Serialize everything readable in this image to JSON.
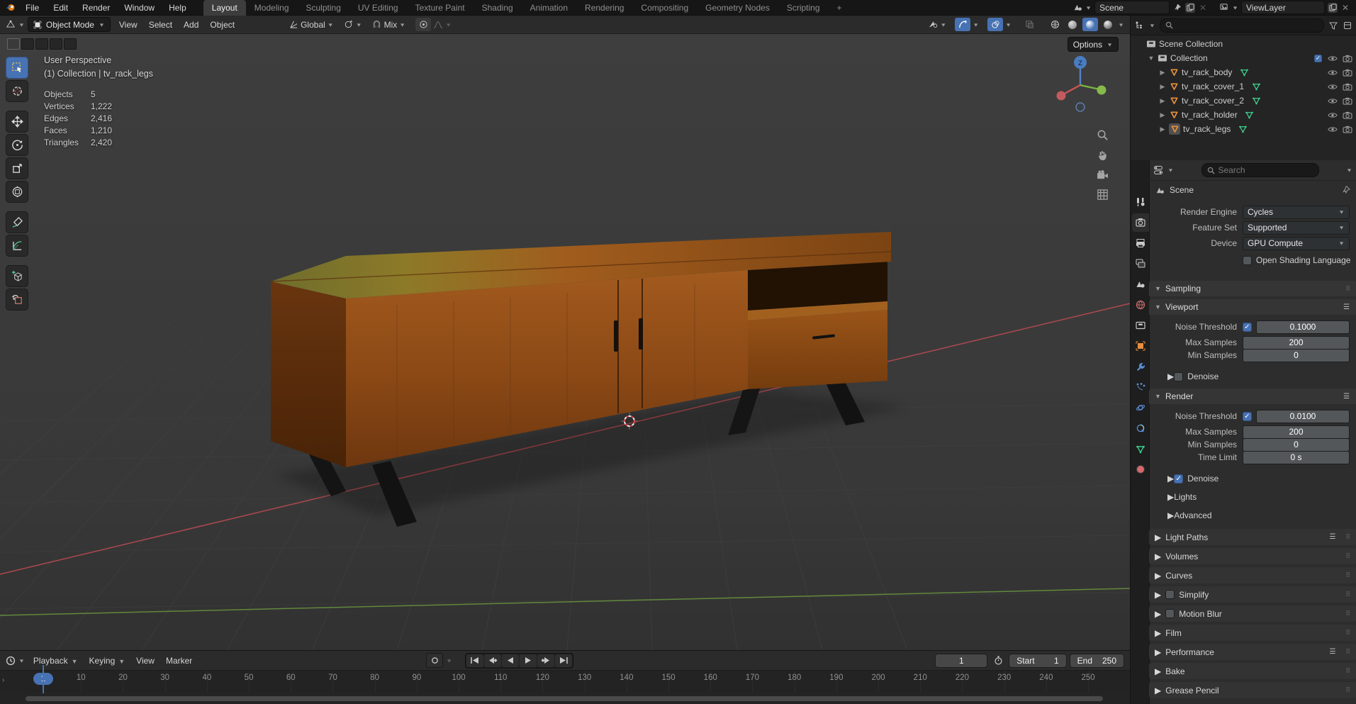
{
  "topbar": {
    "menus": [
      "File",
      "Edit",
      "Render",
      "Window",
      "Help"
    ],
    "workspaces": [
      "Layout",
      "Modeling",
      "Sculpting",
      "UV Editing",
      "Texture Paint",
      "Shading",
      "Animation",
      "Rendering",
      "Compositing",
      "Geometry Nodes",
      "Scripting"
    ],
    "active_workspace": "Layout",
    "new_workspace_label": "+",
    "scene_name": "Scene",
    "viewlayer_name": "ViewLayer"
  },
  "viewport": {
    "header": {
      "mode": "Object Mode",
      "menus": [
        "View",
        "Select",
        "Add",
        "Object"
      ],
      "orientation": "Global",
      "snap_target": "Mix",
      "options_label": "Options"
    },
    "tool_settings_modes": [
      "new",
      "extend",
      "subtract",
      "invert",
      "intersect"
    ],
    "toolbar": [
      "select-box",
      "cursor",
      "move",
      "rotate",
      "scale",
      "transform",
      "annotate",
      "measure",
      "add-cube",
      "add-primitive"
    ],
    "active_tool": "select-box",
    "overlay": {
      "view_name": "User Perspective",
      "context": "(1) Collection | tv_rack_legs",
      "stats": [
        {
          "label": "Objects",
          "value": "5"
        },
        {
          "label": "Vertices",
          "value": "1,222"
        },
        {
          "label": "Edges",
          "value": "2,416"
        },
        {
          "label": "Faces",
          "value": "1,210"
        },
        {
          "label": "Triangles",
          "value": "2,420"
        }
      ]
    },
    "gizmo_axis_label": "Z"
  },
  "outliner": {
    "rows": [
      {
        "name": "Scene Collection",
        "type": "scene-collection",
        "depth": 0,
        "arrow": "",
        "checkbox": false,
        "selected": false
      },
      {
        "name": "Collection",
        "type": "collection",
        "depth": 1,
        "arrow": "down",
        "checkbox": true,
        "selected": false
      },
      {
        "name": "tv_rack_body",
        "type": "mesh",
        "depth": 2,
        "arrow": "right",
        "checkbox": false,
        "selected": false
      },
      {
        "name": "tv_rack_cover_1",
        "type": "mesh",
        "depth": 2,
        "arrow": "right",
        "checkbox": false,
        "selected": false
      },
      {
        "name": "tv_rack_cover_2",
        "type": "mesh",
        "depth": 2,
        "arrow": "right",
        "checkbox": false,
        "selected": false
      },
      {
        "name": "tv_rack_holder",
        "type": "mesh",
        "depth": 2,
        "arrow": "right",
        "checkbox": false,
        "selected": false
      },
      {
        "name": "tv_rack_legs",
        "type": "mesh",
        "depth": 2,
        "arrow": "right",
        "checkbox": false,
        "selected": true
      }
    ]
  },
  "properties": {
    "search_placeholder": "Search",
    "breadcrumb": "Scene",
    "tabs": [
      "tool",
      "render",
      "output",
      "view-layer",
      "scene",
      "world",
      "collection",
      "object",
      "modifiers",
      "particles",
      "physics",
      "constraints",
      "data",
      "material"
    ],
    "active_tab": "render",
    "render_engine_label": "Render Engine",
    "render_engine": "Cycles",
    "feature_set_label": "Feature Set",
    "feature_set": "Supported",
    "device_label": "Device",
    "device": "GPU Compute",
    "osl_label": "Open Shading Language",
    "sampling": {
      "title": "Sampling",
      "viewport": {
        "title": "Viewport",
        "noise_threshold_label": "Noise Threshold",
        "noise_threshold": "0.1000",
        "noise_threshold_enabled": true,
        "max_samples_label": "Max Samples",
        "max_samples": "200",
        "min_samples_label": "Min Samples",
        "min_samples": "0",
        "denoise_label": "Denoise",
        "denoise_enabled": false
      },
      "render": {
        "title": "Render",
        "noise_threshold_label": "Noise Threshold",
        "noise_threshold": "0.0100",
        "noise_threshold_enabled": true,
        "max_samples_label": "Max Samples",
        "max_samples": "200",
        "min_samples_label": "Min Samples",
        "min_samples": "0",
        "time_limit_label": "Time Limit",
        "time_limit": "0 s",
        "denoise_label": "Denoise",
        "denoise_enabled": true,
        "lights_label": "Lights",
        "advanced_label": "Advanced"
      }
    },
    "collapsed_sections": [
      {
        "label": "Light Paths",
        "list_icon": true,
        "checkbox": false
      },
      {
        "label": "Volumes",
        "list_icon": false,
        "checkbox": false
      },
      {
        "label": "Curves",
        "list_icon": false,
        "checkbox": false
      },
      {
        "label": "Simplify",
        "list_icon": false,
        "checkbox": true
      },
      {
        "label": "Motion Blur",
        "list_icon": false,
        "checkbox": true
      },
      {
        "label": "Film",
        "list_icon": false,
        "checkbox": false
      },
      {
        "label": "Performance",
        "list_icon": true,
        "checkbox": false
      },
      {
        "label": "Bake",
        "list_icon": false,
        "checkbox": false
      },
      {
        "label": "Grease Pencil",
        "list_icon": false,
        "checkbox": false
      }
    ]
  },
  "timeline": {
    "menus": [
      "Playback",
      "Keying",
      "View",
      "Marker"
    ],
    "current_frame": "1",
    "frame_ticks": [
      10,
      20,
      30,
      40,
      50,
      60,
      70,
      80,
      90,
      100,
      110,
      120,
      130,
      140,
      150,
      160,
      170,
      180,
      190,
      200,
      210,
      220,
      230,
      240,
      250
    ],
    "start_label": "Start",
    "start_value": "1",
    "end_label": "End",
    "end_value": "250"
  },
  "colors": {
    "accent_blue": "#4772b3",
    "mesh_orange": "#e7903c",
    "mesh_data_green": "#3ecf8e",
    "axis_red": "#bb4b52",
    "axis_green": "#6f9d3f"
  }
}
